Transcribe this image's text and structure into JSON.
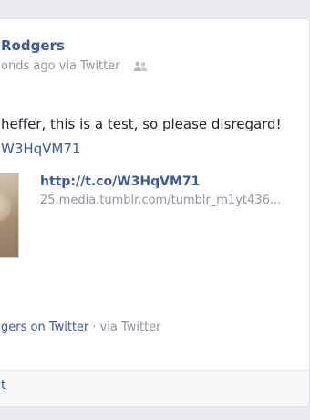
{
  "post": {
    "author": "Rodgers",
    "meta_text": "onds ago via Twitter",
    "message": "heffer, this is a test, so please disregard!",
    "message_link": "W3HqVM71",
    "attachment": {
      "title": "http://t.co/W3HqVM71",
      "url": "25.media.tumblr.com/tumblr_m1yt436..."
    },
    "source": {
      "link_text": "gers on Twitter",
      "separator": "·",
      "via_text": "via Twitter"
    },
    "action_label": "t"
  },
  "icons": {
    "audience": "people-icon"
  },
  "colors": {
    "link": "#3b5998",
    "muted": "#90949c",
    "text": "#1d2129",
    "background": "#e9ebee",
    "card": "#ffffff",
    "action_bar": "#f6f7f9"
  }
}
